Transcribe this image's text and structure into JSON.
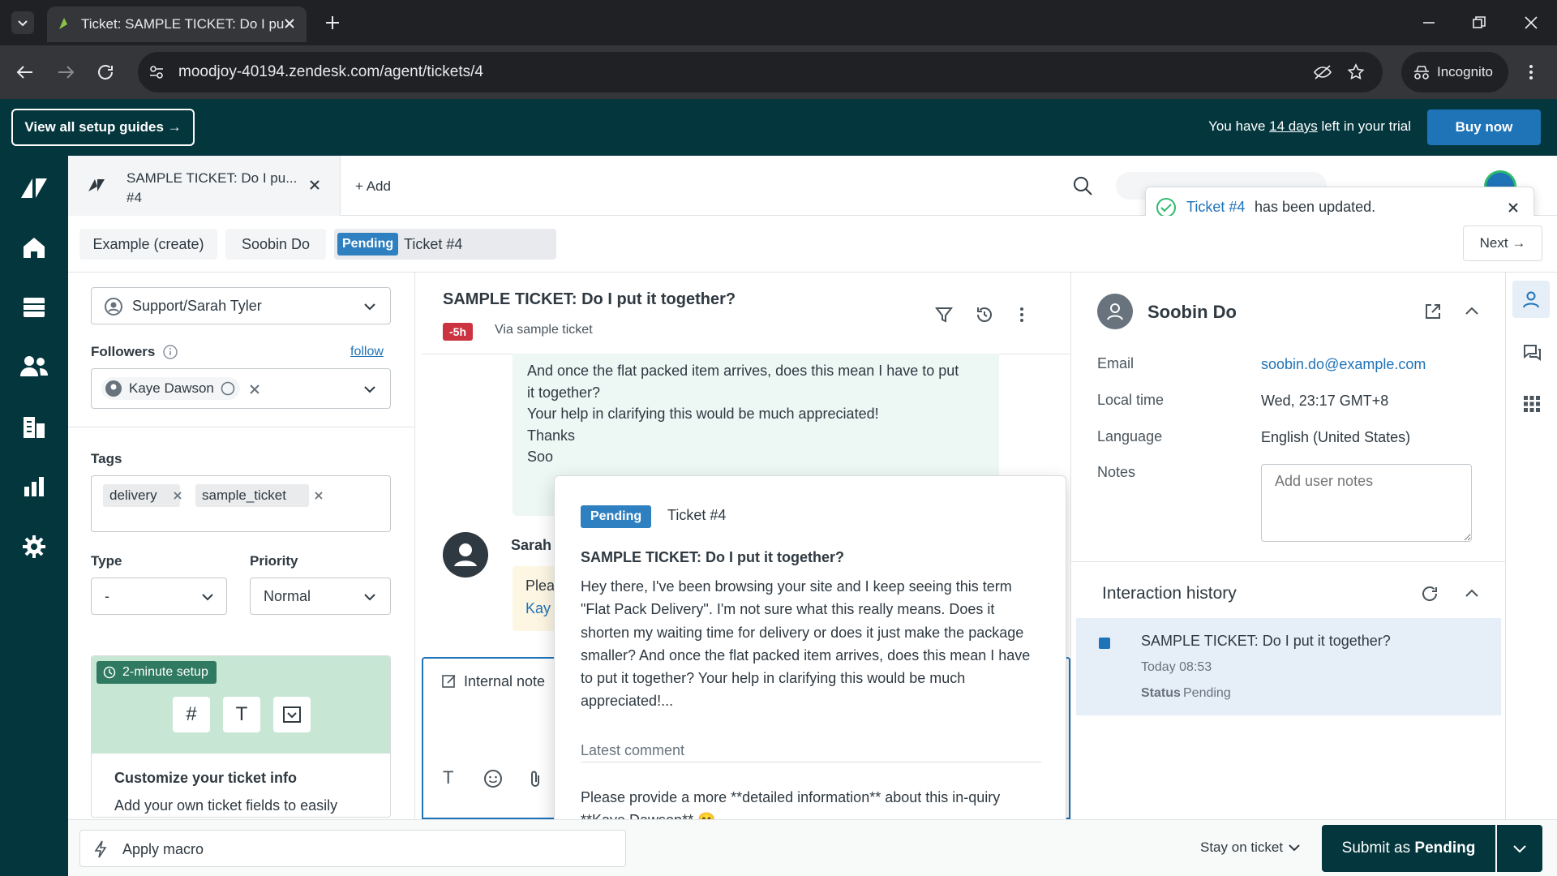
{
  "browser": {
    "tab_title": "Ticket: SAMPLE TICKET: Do I pu",
    "url": "moodjoy-40194.zendesk.com/agent/tickets/4",
    "incognito_label": "Incognito"
  },
  "setup": {
    "guides_label": "View all setup guides →",
    "trial_prefix": "You have",
    "trial_days": "14 days",
    "trial_suffix": "left in your trial",
    "buy_label": "Buy now"
  },
  "workspace_tab": {
    "title": "SAMPLE TICKET: Do I pu...",
    "number": "#4",
    "add_label": "+ Add"
  },
  "toast": {
    "link": "Ticket #4",
    "text": "has been updated."
  },
  "breadcrumbs": {
    "create": "Example (create)",
    "requester": "Soobin Do",
    "status": "Pending",
    "ticket": "Ticket #4",
    "next": "Next →"
  },
  "fields": {
    "assignee": "Support/Sarah Tyler",
    "followers_label": "Followers",
    "follow_link": "follow",
    "follower": "Kaye Dawson",
    "tags_label": "Tags",
    "tags": [
      "delivery",
      "sample_ticket"
    ],
    "type_label": "Type",
    "type_value": "-",
    "priority_label": "Priority",
    "priority_value": "Normal"
  },
  "setup_card": {
    "badge": "2-minute setup",
    "title": "Customize your ticket info",
    "text": "Add your own ticket fields to easily"
  },
  "ticket": {
    "subject": "SAMPLE TICKET: Do I put it together?",
    "sla": "-5h",
    "via": "Via sample ticket",
    "msg_lines": [
      "And once the flat packed item arrives, does this mean I have to put",
      "it together?",
      "",
      "Your help in clarifying this would be much appreciated!",
      "",
      "Thanks",
      "Soo"
    ],
    "agent": "Sarah",
    "reply_partial": "Plea",
    "reply_partial2": "Kay",
    "internal_note": "Internal note"
  },
  "popover": {
    "status": "Pending",
    "ticket": "Ticket #4",
    "subject": "SAMPLE TICKET: Do I put it together?",
    "body": "Hey there, I've been browsing your site and I keep seeing this term \"Flat Pack Delivery\". I'm not sure what this really means. Does it shorten my waiting time for delivery or does it just make the package smaller? And once the flat packed item arrives, does this mean I have to put it together? Your help in clarifying this would be much appreciated!...",
    "latest_label": "Latest comment",
    "latest": "Please provide a more **detailed information** about this in-quiry **Kaye Dawson** 😊"
  },
  "user": {
    "name": "Soobin Do",
    "email_label": "Email",
    "email": "soobin.do@example.com",
    "time_label": "Local time",
    "time": "Wed, 23:17 GMT+8",
    "lang_label": "Language",
    "lang": "English (United States)",
    "notes_label": "Notes",
    "notes_placeholder": "Add user notes"
  },
  "history": {
    "title": "Interaction history",
    "item_title": "SAMPLE TICKET: Do I put it together?",
    "item_time": "Today 08:53",
    "item_status_label": "Status",
    "item_status": "Pending"
  },
  "footer": {
    "macro": "Apply macro",
    "stay": "Stay on ticket",
    "submit_prefix": "Submit as",
    "submit_status": "Pending"
  },
  "colors": {
    "dark": "#03363d",
    "blue": "#1f73b7",
    "pending": "#2f80c0"
  }
}
